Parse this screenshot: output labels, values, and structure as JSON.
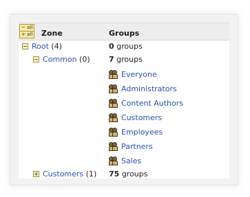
{
  "toggles": {
    "collapse_all": "− all",
    "expand_all": "+ all"
  },
  "columns": {
    "zone": "Zone",
    "groups": "Groups"
  },
  "tree": {
    "root": {
      "name": "Root",
      "count": "(4)",
      "groups_num": "0",
      "groups_word": "groups"
    },
    "common": {
      "name": "Common",
      "count": "(0)",
      "groups_num": "7",
      "groups_word": "groups",
      "group_list": [
        "Everyone",
        "Administrators",
        "Content Authors",
        "Customers",
        "Employees",
        "Partners",
        "Sales"
      ]
    },
    "customers": {
      "name": "Customers",
      "count": "(1)",
      "groups_num": "75",
      "groups_word": "groups"
    }
  },
  "colors": {
    "link": "#2a4fb0",
    "toggle_bg": "#f7e9a8",
    "header_bg": "#ededed"
  }
}
